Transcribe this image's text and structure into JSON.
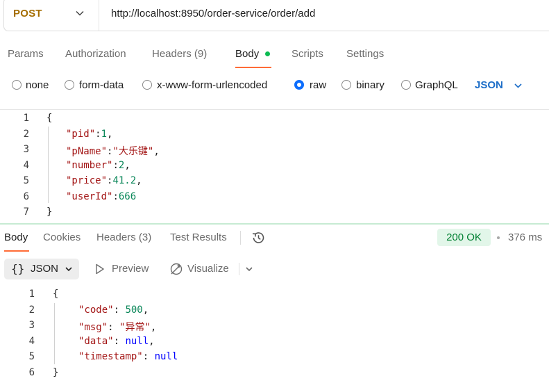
{
  "request": {
    "method": "POST",
    "url": "http://localhost:8950/order-service/order/add",
    "tabs": {
      "params": "Params",
      "authorization": "Authorization",
      "headers": "Headers",
      "headers_count": "(9)",
      "body": "Body",
      "scripts": "Scripts",
      "settings": "Settings"
    },
    "body_types": {
      "none": "none",
      "form_data": "form-data",
      "urlencoded": "x-www-form-urlencoded",
      "raw": "raw",
      "binary": "binary",
      "graphql": "GraphQL",
      "format": "JSON"
    },
    "selected_body_type": "raw",
    "active_tab": "Body",
    "body_code": {
      "line_numbers": [
        "1",
        "2",
        "3",
        "4",
        "5",
        "6",
        "7"
      ],
      "open": "{",
      "close": "}",
      "pid_key": "\"pid\"",
      "pid_val": "1",
      "pname_key": "\"pName\"",
      "pname_val": "\"大乐键\"",
      "number_key": "\"number\"",
      "number_val": "2",
      "price_key": "\"price\"",
      "price_val": "41.2",
      "userid_key": "\"userId\"",
      "userid_val": "666"
    }
  },
  "response": {
    "tabs": {
      "body": "Body",
      "cookies": "Cookies",
      "headers": "Headers",
      "headers_count": "(3)",
      "test_results": "Test Results"
    },
    "status": "200 OK",
    "time": "376 ms",
    "toolbar": {
      "format_braces": "{}",
      "format": "JSON",
      "preview": "Preview",
      "visualize": "Visualize"
    },
    "body_code": {
      "line_numbers": [
        "1",
        "2",
        "3",
        "4",
        "5",
        "6"
      ],
      "open": "{",
      "close": "}",
      "code_key": "\"code\"",
      "code_val": "500",
      "msg_key": "\"msg\"",
      "msg_val": "\"异常\"",
      "data_key": "\"data\"",
      "data_val": "null",
      "ts_key": "\"timestamp\"",
      "ts_val": "null"
    }
  },
  "colors": {
    "accent_orange": "#ff6c37",
    "method": "#a46d00",
    "radio_selected": "#0d6efd",
    "status_ok": "#007f31",
    "status_ok_bg": "#e2f6e9"
  }
}
